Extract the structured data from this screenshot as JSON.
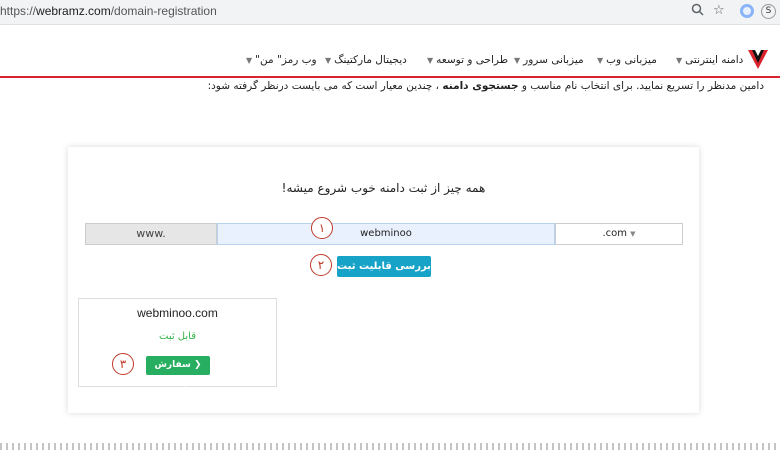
{
  "browser": {
    "url_scheme": "https://",
    "url_host": "webramz.com",
    "url_path": "/domain-registration",
    "zoom_icon": "magnifier-icon",
    "star_icon": "star-icon"
  },
  "nav": {
    "items": [
      {
        "label": "دامنه اینترنتی"
      },
      {
        "label": "میزبانی وب"
      },
      {
        "label": "میزبانی سرور"
      },
      {
        "label": "طراحی و توسعه"
      },
      {
        "label": "دیجیتال مارکتینگ"
      },
      {
        "label": "\"وب رمز\" من"
      }
    ]
  },
  "intro": {
    "part1": "دامین مدنظر را تسریع نمایید. برای انتخاب نام مناسب و ",
    "bold": "جستجوی دامنه",
    "part2": " ، چندین معیار است که می بایست درنظر گرفته شود:"
  },
  "card": {
    "headline": "همه چیز از ثبت دامنه خوب شروع میشه!",
    "www": "www.",
    "domain_value": "webminoo",
    "extension": ".com",
    "check_button": "بررسی قابلیت ثبت",
    "markers": [
      "۱",
      "۲",
      "۳"
    ]
  },
  "result": {
    "domain": "webminoo.com",
    "status": "قابل ثبت",
    "order_button": "سفارش دهید"
  },
  "colors": {
    "accent_red": "#d9232d",
    "check_button": "#17a2c8",
    "order_button": "#27ae60",
    "available_text": "#35b34a"
  }
}
